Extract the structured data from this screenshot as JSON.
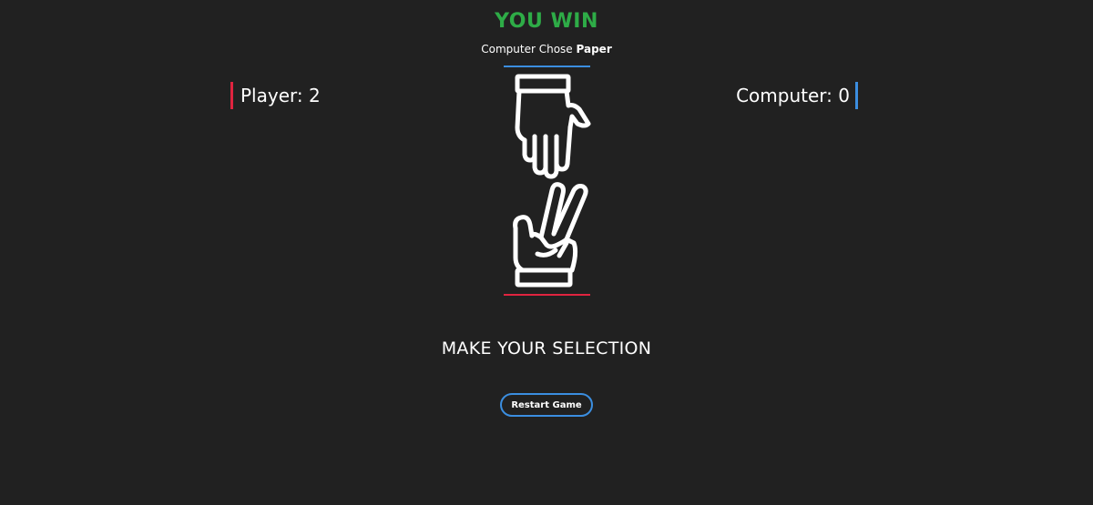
{
  "result": {
    "title": "YOU WIN",
    "subtitle_prefix": "Computer Chose",
    "computer_choice": "Paper",
    "title_color": "#2eac47"
  },
  "scores": {
    "player_label": "Player: 2",
    "computer_label": "Computer: 0",
    "player_color": "#e0243f",
    "computer_color": "#3b8ee0"
  },
  "hands": {
    "computer_icon": "paper-hand-icon",
    "player_icon": "scissors-hand-icon"
  },
  "prompt": "MAKE YOUR SELECTION",
  "restart_label": "Restart Game"
}
